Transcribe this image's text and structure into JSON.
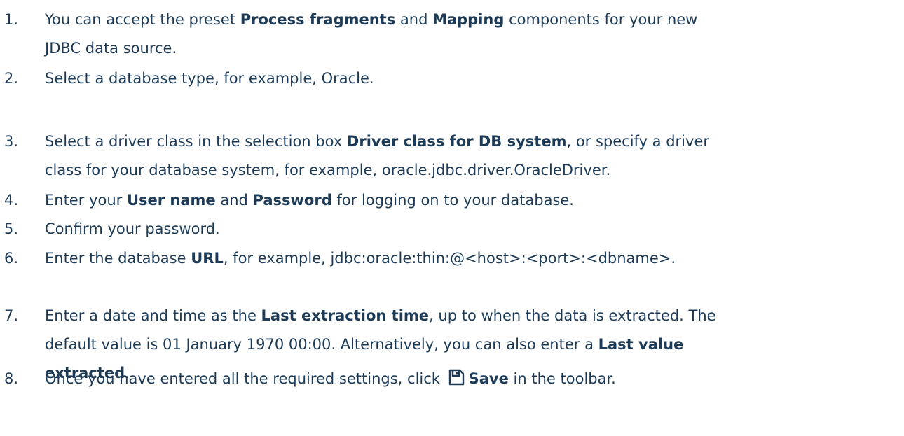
{
  "steps": [
    {
      "number": "1.",
      "lines": [
        [
          "You can accept the preset ",
          {
            "b": "Process fragments"
          },
          " and ",
          {
            "b": "Mapping"
          },
          " components for your new"
        ],
        [
          "JDBC data source."
        ]
      ]
    },
    {
      "number": "2.",
      "lines": [
        [
          "Select a database type, for example, Oracle."
        ]
      ]
    },
    {
      "number": "3.",
      "lines": [
        [
          "Select a driver class in the selection box ",
          {
            "b": "Driver class for DB system"
          },
          ", or specify a driver"
        ],
        [
          "class for your database system, for example, oracle.jdbc.driver.OracleDriver."
        ]
      ]
    },
    {
      "number": "4.",
      "lines": [
        [
          "Enter your ",
          {
            "b": "User name"
          },
          " and ",
          {
            "b": "Password"
          },
          " for logging on to your database."
        ]
      ]
    },
    {
      "number": "5.",
      "lines": [
        [
          "Confirm your password."
        ]
      ]
    },
    {
      "number": "6.",
      "lines": [
        [
          "Enter the database ",
          {
            "b": "URL"
          },
          ", for example, jdbc:oracle:thin:@<host>:<port>:<dbname>."
        ]
      ]
    },
    {
      "number": "7.",
      "lines": [
        [
          "Enter a date and time as the ",
          {
            "b": "Last extraction time"
          },
          ", up to when the data is extracted. The"
        ],
        [
          "default value is 01 January 1970 00:00. Alternatively, you can also enter a ",
          {
            "b": "Last value"
          }
        ],
        [
          {
            "b": "extracted"
          },
          "."
        ]
      ]
    },
    {
      "number": "8.",
      "lines": [
        [
          "Once you have entered all the required settings, click ",
          {
            "icon": "save-icon"
          },
          {
            "b": "Save"
          },
          " in the toolbar."
        ]
      ]
    }
  ]
}
